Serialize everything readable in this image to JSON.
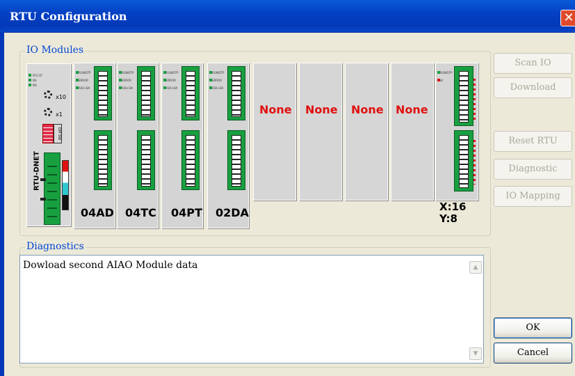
{
  "window": {
    "title": "RTU Configuration",
    "close_glyph": "✕"
  },
  "io_group": {
    "label": "IO Modules"
  },
  "diagnostics": {
    "label": "Diagnostics",
    "message": "Dowload second AIAO Module data"
  },
  "rtu": {
    "name": "RTU-DNET",
    "leds": [
      "RTU.ST",
      "NS",
      "MS"
    ],
    "rotary": [
      "x10",
      "x1"
    ],
    "dip_label": "DIP SW"
  },
  "modules": [
    {
      "label": "04AD",
      "leds": [
        "RUN/STP",
        "ERROR",
        "A/D+DA"
      ]
    },
    {
      "label": "04TC",
      "leds": [
        "RUN/STP",
        "ERROR",
        "A/D+DA"
      ]
    },
    {
      "label": "04PT",
      "leds": [
        "RUN/STP",
        "ERROR",
        "A/D+DA"
      ]
    },
    {
      "label": "02DA",
      "leds": [
        "RUN/STP",
        "ERROR",
        "A/D+DA"
      ]
    }
  ],
  "empty_slots": [
    "None",
    "None",
    "None",
    "None"
  ],
  "io_module": {
    "leds": [
      "RUN/STP",
      "LV"
    ],
    "x_label": "X:16",
    "y_label": "Y:8"
  },
  "buttons": {
    "scan_io": "Scan IO",
    "download": "Download",
    "reset_rtu": "Reset RTU",
    "diagnostic": "Diagnostic",
    "io_mapping": "IO Mapping",
    "ok": "OK",
    "cancel": "Cancel"
  },
  "colors": {
    "title_bar": "#0441c4",
    "module_green": "#18a040",
    "none_red": "#e01010",
    "group_label": "#0046d5"
  }
}
